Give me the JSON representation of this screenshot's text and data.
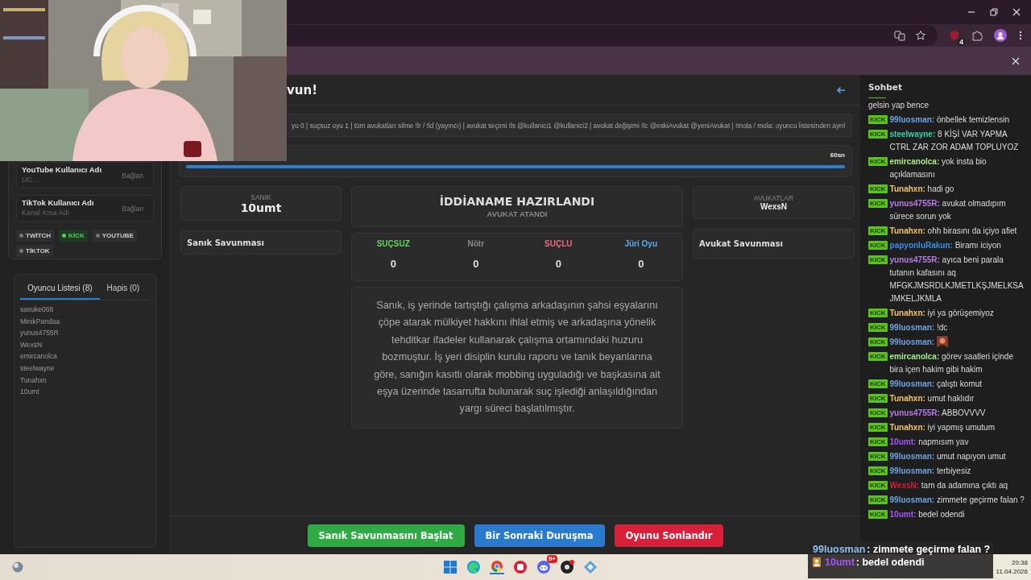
{
  "browser": {
    "extension_badge": "4"
  },
  "app": {
    "title": "vun!",
    "commands": "yu 0 | suçsuz oyu 1 | tüm avukatları silme !lr / !ld (yayıncı) | avukat seçimi !ls @kullanici1 @kullanici2 | avukat değişimi !lc @eskiAvukat @yeniAvukat | !mola / mola: oyuncu listesinden ayrıl",
    "timer": {
      "label": "60sn",
      "level": 1.0
    }
  },
  "sidebar": {
    "fields": [
      {
        "label": "YouTube Kullanıcı Adı",
        "placeholder": "UC...",
        "button": "Bağlan"
      },
      {
        "label": "TikTok Kullanıcı Adı",
        "placeholder": "Kanal Kısa Adı",
        "button": "Bağlan"
      }
    ],
    "platforms": [
      {
        "label": "TWİTCH",
        "on": false
      },
      {
        "label": "KİCK",
        "on": true
      },
      {
        "label": "YOUTUBE",
        "on": false
      },
      {
        "label": "TİKTOK",
        "on": false
      }
    ],
    "tabs": [
      {
        "label": "Oyuncu Listesi (8)",
        "selected": true
      },
      {
        "label": "Hapis (0)",
        "selected": false
      }
    ],
    "players": [
      "sasuke068",
      "MinikPandaa",
      "yunus4755R",
      "WexsN",
      "emircanolca",
      "steelwayne",
      "Tunahxn",
      "10umt"
    ]
  },
  "defendant": {
    "label": "SANIK",
    "name": "10umt"
  },
  "defense_left": "Sanık Savunması",
  "status": {
    "title": "İDDİANAME HAZIRLANDI",
    "subtitle": "AVUKAT ATANDI"
  },
  "votes": [
    {
      "label": "SUÇSUZ",
      "count": "0",
      "color": "#5fd35a"
    },
    {
      "label": "Nötr",
      "count": "0",
      "color": "#8a8a8a"
    },
    {
      "label": "SUÇLU",
      "count": "0",
      "color": "#f06a7a"
    },
    {
      "label": "Jüri Oyu",
      "count": "0",
      "color": "#5aa8f0"
    }
  ],
  "indictment": "Sanık, iş yerinde tartıştığı çalışma arkadaşının şahsi eşyalarını çöpe atarak mülkiyet hakkını ihlal etmiş ve arkadaşına yönelik tehditkar ifadeler kullanarak çalışma ortamındaki huzuru bozmuştur. İş yeri disiplin kurulu raporu ve tanık beyanlarına göre, sanığın kasıtlı olarak mobbing uyguladığı ve başkasına ait eşya üzerinde tasarrufta bulunarak suç işlediği anlaşıldığından yargı süreci başlatılmıştır.",
  "lawyers": {
    "label": "AVUKATLAR",
    "name": "WexsN"
  },
  "defense_right": "Avukat Savunması",
  "actions": [
    {
      "label": "Sanık Savunmasını Başlat",
      "color": "#2faa45"
    },
    {
      "label": "Bir Sonraki Duruşma",
      "color": "#2a7bd0"
    },
    {
      "label": "Oyunu Sonlandır",
      "color": "#d8203a"
    }
  ],
  "chat": {
    "title": "Sohbet",
    "messages": [
      {
        "kind": "continuation",
        "text": "gelsin yap bence"
      },
      {
        "kind": "text",
        "badge": "KICK",
        "user": "99luosman:",
        "color": "#6fa3e0",
        "text": "önbellek temizlensin"
      },
      {
        "kind": "text",
        "badge": "KICK",
        "user": "steelwayne:",
        "color": "#3ccfae",
        "text": "8 KİŞİ VAR YAPMA CTRL ZAR ZOR ADAM TOPLUYOZ"
      },
      {
        "kind": "text",
        "badge": "KICK",
        "user": "emircanolca:",
        "color": "#a6e88a",
        "text": "yok insta bio açıklamasını"
      },
      {
        "kind": "text",
        "badge": "KICK",
        "user": "Tunahxn:",
        "color": "#f2c46a",
        "text": "hadi go"
      },
      {
        "kind": "text",
        "badge": "KICK",
        "user": "yunus4755R:",
        "color": "#b77be6",
        "text": "avukat olmadıpım sürece sorun yok"
      },
      {
        "kind": "text",
        "badge": "KICK",
        "user": "Tunahxn:",
        "color": "#f2c46a",
        "text": "ohh birasını da içiyo afiet"
      },
      {
        "kind": "text",
        "badge": "KICK",
        "user": "papyonluRakun:",
        "color": "#3a8ee6",
        "text": "Biramı iciyon"
      },
      {
        "kind": "text",
        "badge": "KICK",
        "user": "yunus4755R:",
        "color": "#b77be6",
        "text": "ayıca beni parala tutanın kafasını aq MFGKJMSRDLKJMETLKŞJMELKSAJMKELJKMLA"
      },
      {
        "kind": "text",
        "badge": "KICK",
        "user": "Tunahxn:",
        "color": "#f2c46a",
        "text": "iyi ya görüşemiyoz"
      },
      {
        "kind": "text",
        "badge": "KICK",
        "user": "99luosman:",
        "color": "#6fa3e0",
        "text": "!dc"
      },
      {
        "kind": "emote",
        "badge": "KICK",
        "user": "99luosman:",
        "color": "#6fa3e0"
      },
      {
        "kind": "text",
        "badge": "KICK",
        "user": "emircanolca:",
        "color": "#a6e88a",
        "text": "görev saatleri içinde bira içen hakim gibi hakim"
      },
      {
        "kind": "text",
        "badge": "KICK",
        "user": "99luosman:",
        "color": "#6fa3e0",
        "text": "çalıştı komut"
      },
      {
        "kind": "text",
        "badge": "KICK",
        "user": "Tunahxn:",
        "color": "#f2c46a",
        "text": "umut haklıdır"
      },
      {
        "kind": "text",
        "badge": "KICK",
        "user": "yunus4755R:",
        "color": "#b77be6",
        "text": "ABBOVVVV"
      },
      {
        "kind": "text",
        "badge": "KICK",
        "user": "Tunahxn:",
        "color": "#f2c46a",
        "text": "iyi yapmış umutum"
      },
      {
        "kind": "text",
        "badge": "KICK",
        "user": "10umt:",
        "color": "#a855f7",
        "text": "napmısım yav"
      },
      {
        "kind": "text",
        "badge": "KICK",
        "user": "99luosman:",
        "color": "#6fa3e0",
        "text": "umut napıyon umut"
      },
      {
        "kind": "text",
        "badge": "KICK",
        "user": "99luosman:",
        "color": "#6fa3e0",
        "text": "terbiyesiz"
      },
      {
        "kind": "text",
        "badge": "KICK",
        "user": "WexsN:",
        "color": "#d0203a",
        "text": "tam da adamına çıktı aq"
      },
      {
        "kind": "text",
        "badge": "KICK",
        "user": "99luosman:",
        "color": "#6fa3e0",
        "text": "zimmete geçirme falan ?"
      },
      {
        "kind": "text",
        "badge": "KICK",
        "user": "10umt:",
        "color": "#a855f7",
        "text": "bedel odendi"
      }
    ]
  },
  "overlay": [
    {
      "kind": "plain",
      "user": "99luosman",
      "color": "#8fc0f0",
      "text": ": zimmete geçirme falan ?"
    },
    {
      "kind": "icon",
      "user": "10umt",
      "color": "#a855f7",
      "text": ": bedel odendi"
    }
  ],
  "taskbar": {
    "discord_badge": "9+",
    "time": "20:38",
    "date": "11.04.2026"
  }
}
